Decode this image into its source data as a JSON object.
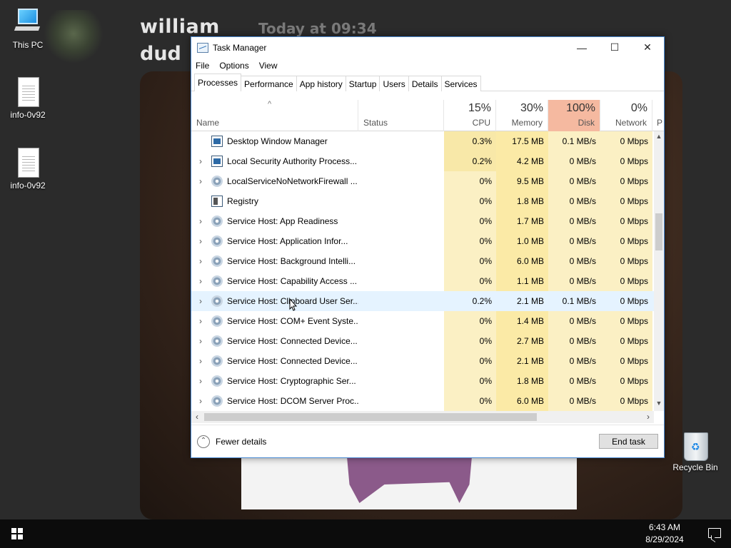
{
  "desktop": {
    "chat_user": "william",
    "chat_time": "Today at 09:34",
    "chat_line2": "dud",
    "icons": [
      {
        "label": "This PC",
        "icon": "computer-icon"
      },
      {
        "label": "info-0v92",
        "icon": "document-icon"
      },
      {
        "label": "info-0v92",
        "icon": "document-icon"
      },
      {
        "label": "Recycle Bin",
        "icon": "recycle-bin-icon"
      }
    ]
  },
  "taskmanager": {
    "title": "Task Manager",
    "menu": [
      "File",
      "Options",
      "View"
    ],
    "tabs": [
      "Processes",
      "Performance",
      "App history",
      "Startup",
      "Users",
      "Details",
      "Services"
    ],
    "active_tab": "Processes",
    "columns": {
      "name": "Name",
      "status": "Status",
      "cpu": {
        "pct": "15%",
        "label": "CPU"
      },
      "memory": {
        "pct": "30%",
        "label": "Memory"
      },
      "disk": {
        "pct": "100%",
        "label": "Disk"
      },
      "network": {
        "pct": "0%",
        "label": "Network"
      },
      "extra": "P"
    },
    "processes": [
      {
        "name": "Desktop Window Manager",
        "cpu": "0.3%",
        "memory": "17.5 MB",
        "disk": "0.1 MB/s",
        "network": "0 Mbps",
        "expandable": false,
        "icon": "window-icon"
      },
      {
        "name": "Local Security Authority Process...",
        "cpu": "0.2%",
        "memory": "4.2 MB",
        "disk": "0 MB/s",
        "network": "0 Mbps",
        "expandable": true,
        "icon": "window-icon"
      },
      {
        "name": "LocalServiceNoNetworkFirewall ...",
        "cpu": "0%",
        "memory": "9.5 MB",
        "disk": "0 MB/s",
        "network": "0 Mbps",
        "expandable": true,
        "icon": "gear-icon"
      },
      {
        "name": "Registry",
        "cpu": "0%",
        "memory": "1.8 MB",
        "disk": "0 MB/s",
        "network": "0 Mbps",
        "expandable": false,
        "icon": "registry-icon"
      },
      {
        "name": "Service Host: App Readiness",
        "cpu": "0%",
        "memory": "1.7 MB",
        "disk": "0 MB/s",
        "network": "0 Mbps",
        "expandable": true,
        "icon": "gear-icon"
      },
      {
        "name": "Service Host: Application Infor...",
        "cpu": "0%",
        "memory": "1.0 MB",
        "disk": "0 MB/s",
        "network": "0 Mbps",
        "expandable": true,
        "icon": "gear-icon"
      },
      {
        "name": "Service Host: Background Intelli...",
        "cpu": "0%",
        "memory": "6.0 MB",
        "disk": "0 MB/s",
        "network": "0 Mbps",
        "expandable": true,
        "icon": "gear-icon"
      },
      {
        "name": "Service Host: Capability Access ...",
        "cpu": "0%",
        "memory": "1.1 MB",
        "disk": "0 MB/s",
        "network": "0 Mbps",
        "expandable": true,
        "icon": "gear-icon"
      },
      {
        "name": "Service Host: Clipboard User Ser...",
        "cpu": "0.2%",
        "memory": "2.1 MB",
        "disk": "0.1 MB/s",
        "network": "0 Mbps",
        "expandable": true,
        "icon": "gear-icon",
        "hover": true
      },
      {
        "name": "Service Host: COM+ Event Syste...",
        "cpu": "0%",
        "memory": "1.4 MB",
        "disk": "0 MB/s",
        "network": "0 Mbps",
        "expandable": true,
        "icon": "gear-icon"
      },
      {
        "name": "Service Host: Connected Device...",
        "cpu": "0%",
        "memory": "2.7 MB",
        "disk": "0 MB/s",
        "network": "0 Mbps",
        "expandable": true,
        "icon": "gear-icon"
      },
      {
        "name": "Service Host: Connected Device...",
        "cpu": "0%",
        "memory": "2.1 MB",
        "disk": "0 MB/s",
        "network": "0 Mbps",
        "expandable": true,
        "icon": "gear-icon"
      },
      {
        "name": "Service Host: Cryptographic Ser...",
        "cpu": "0%",
        "memory": "1.8 MB",
        "disk": "0 MB/s",
        "network": "0 Mbps",
        "expandable": true,
        "icon": "gear-icon"
      },
      {
        "name": "Service Host: DCOM Server Proc...",
        "cpu": "0%",
        "memory": "6.0 MB",
        "disk": "0 MB/s",
        "network": "0 Mbps",
        "expandable": true,
        "icon": "gear-icon"
      }
    ],
    "footer": {
      "fewer_details": "Fewer details",
      "end_task": "End task"
    }
  },
  "taskbar": {
    "time": "6:43 AM",
    "date": "8/29/2024"
  },
  "colors": {
    "disk_header": "#f5b9a0",
    "heat_light": "#fbf0c4",
    "heat_mem": "#fbeaa6",
    "hover_row": "#e5f3ff"
  }
}
